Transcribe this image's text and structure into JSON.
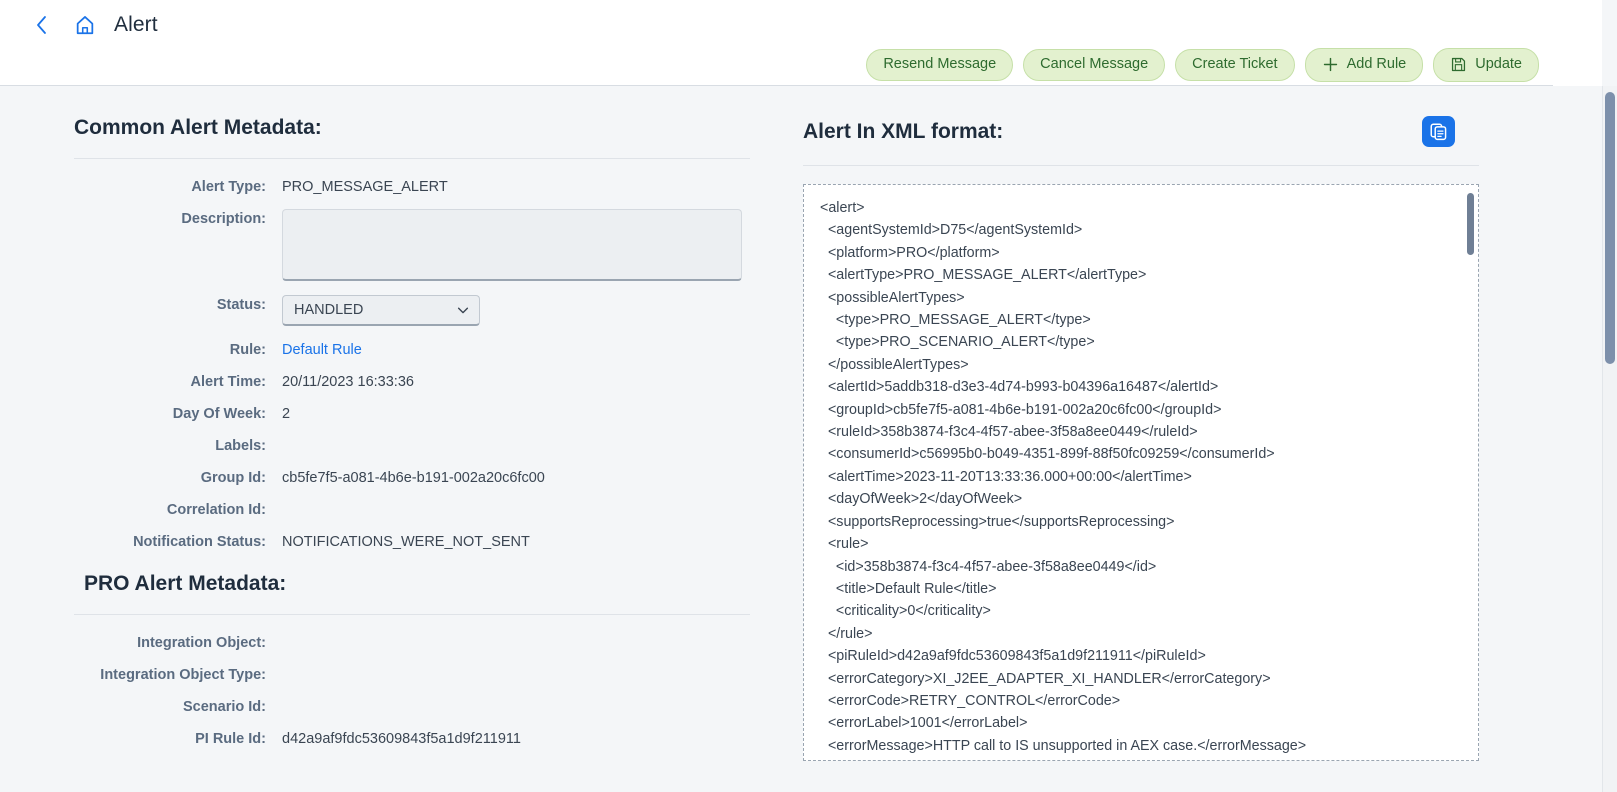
{
  "header": {
    "back_icon": "chevron-left-icon",
    "home_icon": "home-icon",
    "title": "Alert"
  },
  "toolbar": {
    "buttons": [
      {
        "label": "Resend Message",
        "icon": null
      },
      {
        "label": "Cancel Message",
        "icon": null
      },
      {
        "label": "Create Ticket",
        "icon": null
      },
      {
        "label": "Add Rule",
        "icon": "plus-icon"
      },
      {
        "label": "Update",
        "icon": "save-icon"
      }
    ]
  },
  "common_metadata": {
    "title": "Common Alert Metadata:",
    "fields": [
      {
        "label": "Alert Type:",
        "value": "PRO_MESSAGE_ALERT",
        "type": "text"
      },
      {
        "label": "Description:",
        "value": "",
        "type": "textarea"
      },
      {
        "label": "Status:",
        "value": "HANDLED",
        "type": "select"
      },
      {
        "label": "Rule:",
        "value": "Default Rule",
        "type": "link"
      },
      {
        "label": "Alert Time:",
        "value": "20/11/2023 16:33:36",
        "type": "text"
      },
      {
        "label": "Day Of Week:",
        "value": "2",
        "type": "text"
      },
      {
        "label": "Labels:",
        "value": "",
        "type": "text"
      },
      {
        "label": "Group Id:",
        "value": "cb5fe7f5-a081-4b6e-b191-002a20c6fc00",
        "type": "text"
      },
      {
        "label": "Correlation Id:",
        "value": "",
        "type": "text"
      },
      {
        "label": "Notification Status:",
        "value": "NOTIFICATIONS_WERE_NOT_SENT",
        "type": "text"
      }
    ],
    "status_options": [
      "HANDLED"
    ],
    "status_chevron": "chevron-down-icon"
  },
  "pro_metadata": {
    "title": "PRO Alert Metadata:",
    "fields": [
      {
        "label": "Integration Object:",
        "value": "",
        "type": "text"
      },
      {
        "label": "Integration Object Type:",
        "value": "",
        "type": "text"
      },
      {
        "label": "Scenario Id:",
        "value": "",
        "type": "text"
      },
      {
        "label": "PI Rule Id:",
        "value": "d42a9af9fdc53609843f5a1d9f211911",
        "type": "text"
      }
    ]
  },
  "xml_panel": {
    "title": "Alert In XML format:",
    "copy_icon": "copy-icon",
    "content": "<alert>\n  <agentSystemId>D75</agentSystemId>\n  <platform>PRO</platform>\n  <alertType>PRO_MESSAGE_ALERT</alertType>\n  <possibleAlertTypes>\n    <type>PRO_MESSAGE_ALERT</type>\n    <type>PRO_SCENARIO_ALERT</type>\n  </possibleAlertTypes>\n  <alertId>5addb318-d3e3-4d74-b993-b04396a16487</alertId>\n  <groupId>cb5fe7f5-a081-4b6e-b191-002a20c6fc00</groupId>\n  <ruleId>358b3874-f3c4-4f57-abee-3f58a8ee0449</ruleId>\n  <consumerId>c56995b0-b049-4351-899f-88f50fc09259</consumerId>\n  <alertTime>2023-11-20T13:33:36.000+00:00</alertTime>\n  <dayOfWeek>2</dayOfWeek>\n  <supportsReprocessing>true</supportsReprocessing>\n  <rule>\n    <id>358b3874-f3c4-4f57-abee-3f58a8ee0449</id>\n    <title>Default Rule</title>\n    <criticality>0</criticality>\n  </rule>\n  <piRuleId>d42a9af9fdc53609843f5a1d9f211911</piRuleId>\n  <errorCategory>XI_J2EE_ADAPTER_XI_HANDLER</errorCategory>\n  <errorCode>RETRY_CONTROL</errorCode>\n  <errorLabel>1001</errorLabel>\n  <errorMessage>HTTP call to IS unsupported in AEX case.</errorMessage>"
  },
  "colors": {
    "accent_blue": "#1a73e8",
    "button_green_bg": "#e3f1cf",
    "button_green_text": "#2e6b2f",
    "page_bg": "#f4f6f8"
  }
}
